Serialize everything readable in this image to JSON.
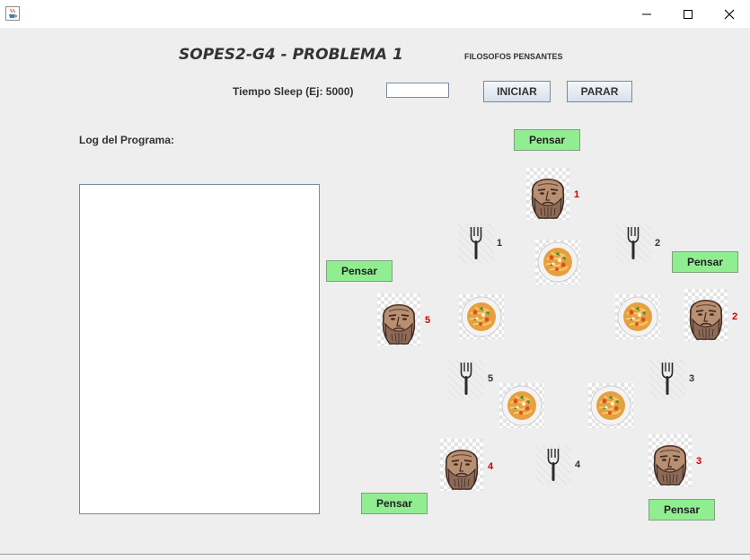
{
  "window": {
    "icons": {
      "app": "java-cup-icon",
      "minimize": "minimize-icon",
      "maximize": "maximize-icon",
      "close": "close-icon"
    }
  },
  "header": {
    "title": "SOPES2-G4 - PROBLEMA 1",
    "subtitle": "FILOSOFOS PENSANTES"
  },
  "controls": {
    "sleep_label": "Tiempo Sleep (Ej: 5000)",
    "sleep_value": "",
    "start_label": "INICIAR",
    "stop_label": "PARAR"
  },
  "log": {
    "label": "Log del Programa:",
    "content": ""
  },
  "philosophers": [
    {
      "number": "1",
      "status": "Pensar",
      "icon": "philosopher-face-icon"
    },
    {
      "number": "2",
      "status": "Pensar",
      "icon": "philosopher-face-icon"
    },
    {
      "number": "3",
      "status": "Pensar",
      "icon": "philosopher-face-icon"
    },
    {
      "number": "4",
      "status": "Pensar",
      "icon": "philosopher-face-icon"
    },
    {
      "number": "5",
      "status": "Pensar",
      "icon": "philosopher-face-icon"
    }
  ],
  "forks": [
    {
      "number": "1",
      "icon": "fork-icon"
    },
    {
      "number": "2",
      "icon": "fork-icon"
    },
    {
      "number": "3",
      "icon": "fork-icon"
    },
    {
      "number": "4",
      "icon": "fork-icon"
    },
    {
      "number": "5",
      "icon": "fork-icon"
    }
  ],
  "plates": {
    "count": 5,
    "icon": "pasta-plate-icon"
  },
  "colors": {
    "status_button": "#90ee90",
    "philosopher_number": "#cc0000",
    "background": "#eeeeee"
  }
}
